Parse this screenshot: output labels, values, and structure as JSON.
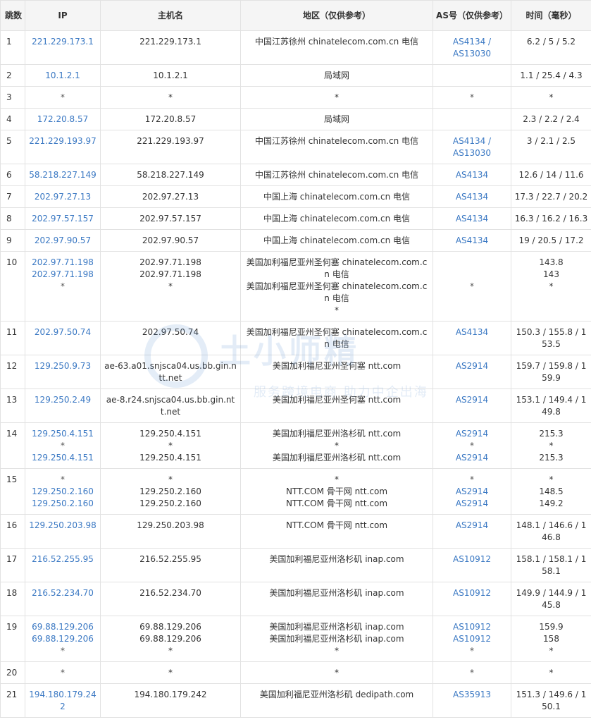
{
  "headers": {
    "hop": "跳数",
    "ip": "IP",
    "host": "主机名",
    "area": "地区（仅供参考）",
    "as": "AS号（仅供参考）",
    "time": "时间（毫秒）"
  },
  "watermark": {
    "title": "土小师精",
    "subtitle": "服务跨境电商 助力中企出海"
  },
  "rows": [
    {
      "hop": "1",
      "ip": [
        "221.229.173.1"
      ],
      "host": [
        "221.229.173.1"
      ],
      "area": [
        "中国江苏徐州 chinatelecom.com.cn 电信"
      ],
      "as": [
        "AS4134 /",
        "AS13030"
      ],
      "time": [
        "6.2 / 5 / 5.2"
      ]
    },
    {
      "hop": "2",
      "ip": [
        "10.1.2.1"
      ],
      "host": [
        "10.1.2.1"
      ],
      "area": [
        "局域网"
      ],
      "as": [
        ""
      ],
      "time": [
        "1.1 / 25.4 / 4.3"
      ]
    },
    {
      "hop": "3",
      "ip": [
        "*"
      ],
      "host": [
        "*"
      ],
      "area": [
        "*"
      ],
      "as": [
        "*"
      ],
      "time": [
        "*"
      ]
    },
    {
      "hop": "4",
      "ip": [
        "172.20.8.57"
      ],
      "host": [
        "172.20.8.57"
      ],
      "area": [
        "局域网"
      ],
      "as": [
        ""
      ],
      "time": [
        "2.3 / 2.2 / 2.4"
      ]
    },
    {
      "hop": "5",
      "ip": [
        "221.229.193.97"
      ],
      "host": [
        "221.229.193.97"
      ],
      "area": [
        "中国江苏徐州 chinatelecom.com.cn 电信"
      ],
      "as": [
        "AS4134 /",
        "AS13030"
      ],
      "time": [
        "3 / 2.1 / 2.5"
      ]
    },
    {
      "hop": "6",
      "ip": [
        "58.218.227.149"
      ],
      "host": [
        "58.218.227.149"
      ],
      "area": [
        "中国江苏徐州 chinatelecom.com.cn 电信"
      ],
      "as": [
        "AS4134"
      ],
      "time": [
        "12.6 / 14 / 11.6"
      ]
    },
    {
      "hop": "7",
      "ip": [
        "202.97.27.13"
      ],
      "host": [
        "202.97.27.13"
      ],
      "area": [
        "中国上海 chinatelecom.com.cn 电信"
      ],
      "as": [
        "AS4134"
      ],
      "time": [
        "17.3 / 22.7 / 20.2"
      ]
    },
    {
      "hop": "8",
      "ip": [
        "202.97.57.157"
      ],
      "host": [
        "202.97.57.157"
      ],
      "area": [
        "中国上海 chinatelecom.com.cn 电信"
      ],
      "as": [
        "AS4134"
      ],
      "time": [
        "16.3 / 16.2 / 16.3"
      ]
    },
    {
      "hop": "9",
      "ip": [
        "202.97.90.57"
      ],
      "host": [
        "202.97.90.57"
      ],
      "area": [
        "中国上海 chinatelecom.com.cn 电信"
      ],
      "as": [
        "AS4134"
      ],
      "time": [
        "19 / 20.5 / 17.2"
      ]
    },
    {
      "hop": "10",
      "ip": [
        "202.97.71.198",
        "202.97.71.198",
        "*"
      ],
      "host": [
        "202.97.71.198",
        "202.97.71.198",
        "*"
      ],
      "area": [
        "美国加利福尼亚州圣何塞 chinatelecom.com.cn 电信",
        "美国加利福尼亚州圣何塞 chinatelecom.com.cn 电信",
        "*"
      ],
      "as": [
        "",
        "",
        "*"
      ],
      "time": [
        "143.8",
        "143",
        "*"
      ]
    },
    {
      "hop": "11",
      "ip": [
        "202.97.50.74"
      ],
      "host": [
        "202.97.50.74"
      ],
      "area": [
        "美国加利福尼亚州圣何塞 chinatelecom.com.cn 电信"
      ],
      "as": [
        "AS4134"
      ],
      "time": [
        "150.3 / 155.8 / 153.5"
      ]
    },
    {
      "hop": "12",
      "ip": [
        "129.250.9.73"
      ],
      "host": [
        "ae-63.a01.snjsca04.us.bb.gin.ntt.net"
      ],
      "area": [
        "美国加利福尼亚州圣何塞 ntt.com"
      ],
      "as": [
        "AS2914"
      ],
      "time": [
        "159.7 / 159.8 / 159.9"
      ]
    },
    {
      "hop": "13",
      "ip": [
        "129.250.2.49"
      ],
      "host": [
        "ae-8.r24.snjsca04.us.bb.gin.ntt.net"
      ],
      "area": [
        "美国加利福尼亚州圣何塞 ntt.com"
      ],
      "as": [
        "AS2914"
      ],
      "time": [
        "153.1 / 149.4 / 149.8"
      ]
    },
    {
      "hop": "14",
      "ip": [
        "129.250.4.151",
        "*",
        "129.250.4.151"
      ],
      "host": [
        "129.250.4.151",
        "*",
        "129.250.4.151"
      ],
      "area": [
        "美国加利福尼亚州洛杉矶 ntt.com",
        "*",
        "美国加利福尼亚州洛杉矶 ntt.com"
      ],
      "as": [
        "AS2914",
        "*",
        "AS2914"
      ],
      "time": [
        "215.3",
        "*",
        "215.3"
      ]
    },
    {
      "hop": "15",
      "ip": [
        "*",
        "129.250.2.160",
        "129.250.2.160"
      ],
      "host": [
        "*",
        "129.250.2.160",
        "129.250.2.160"
      ],
      "area": [
        "*",
        "NTT.COM 骨干网 ntt.com",
        "NTT.COM 骨干网 ntt.com"
      ],
      "as": [
        "*",
        "AS2914",
        "AS2914"
      ],
      "time": [
        "*",
        "148.5",
        "149.2"
      ]
    },
    {
      "hop": "16",
      "ip": [
        "129.250.203.98"
      ],
      "host": [
        "129.250.203.98"
      ],
      "area": [
        "NTT.COM 骨干网 ntt.com"
      ],
      "as": [
        "AS2914"
      ],
      "time": [
        "148.1 / 146.6 / 146.8"
      ]
    },
    {
      "hop": "17",
      "ip": [
        "216.52.255.95"
      ],
      "host": [
        "216.52.255.95"
      ],
      "area": [
        "美国加利福尼亚州洛杉矶 inap.com"
      ],
      "as": [
        "AS10912"
      ],
      "time": [
        "158.1 / 158.1 / 158.1"
      ]
    },
    {
      "hop": "18",
      "ip": [
        "216.52.234.70"
      ],
      "host": [
        "216.52.234.70"
      ],
      "area": [
        "美国加利福尼亚州洛杉矶 inap.com"
      ],
      "as": [
        "AS10912"
      ],
      "time": [
        "149.9 / 144.9 / 145.8"
      ]
    },
    {
      "hop": "19",
      "ip": [
        "69.88.129.206",
        "69.88.129.206",
        "*"
      ],
      "host": [
        "69.88.129.206",
        "69.88.129.206",
        "*"
      ],
      "area": [
        "美国加利福尼亚州洛杉矶 inap.com",
        "美国加利福尼亚州洛杉矶 inap.com",
        "*"
      ],
      "as": [
        "AS10912",
        "AS10912",
        "*"
      ],
      "time": [
        "159.9",
        "158",
        "*"
      ]
    },
    {
      "hop": "20",
      "ip": [
        "*"
      ],
      "host": [
        "*"
      ],
      "area": [
        "*"
      ],
      "as": [
        "*"
      ],
      "time": [
        "*"
      ]
    },
    {
      "hop": "21",
      "ip": [
        "194.180.179.242"
      ],
      "host": [
        "194.180.179.242"
      ],
      "area": [
        "美国加利福尼亚州洛杉矶 dedipath.com"
      ],
      "as": [
        "AS35913"
      ],
      "time": [
        "151.3 / 149.6 / 150.1"
      ]
    }
  ]
}
